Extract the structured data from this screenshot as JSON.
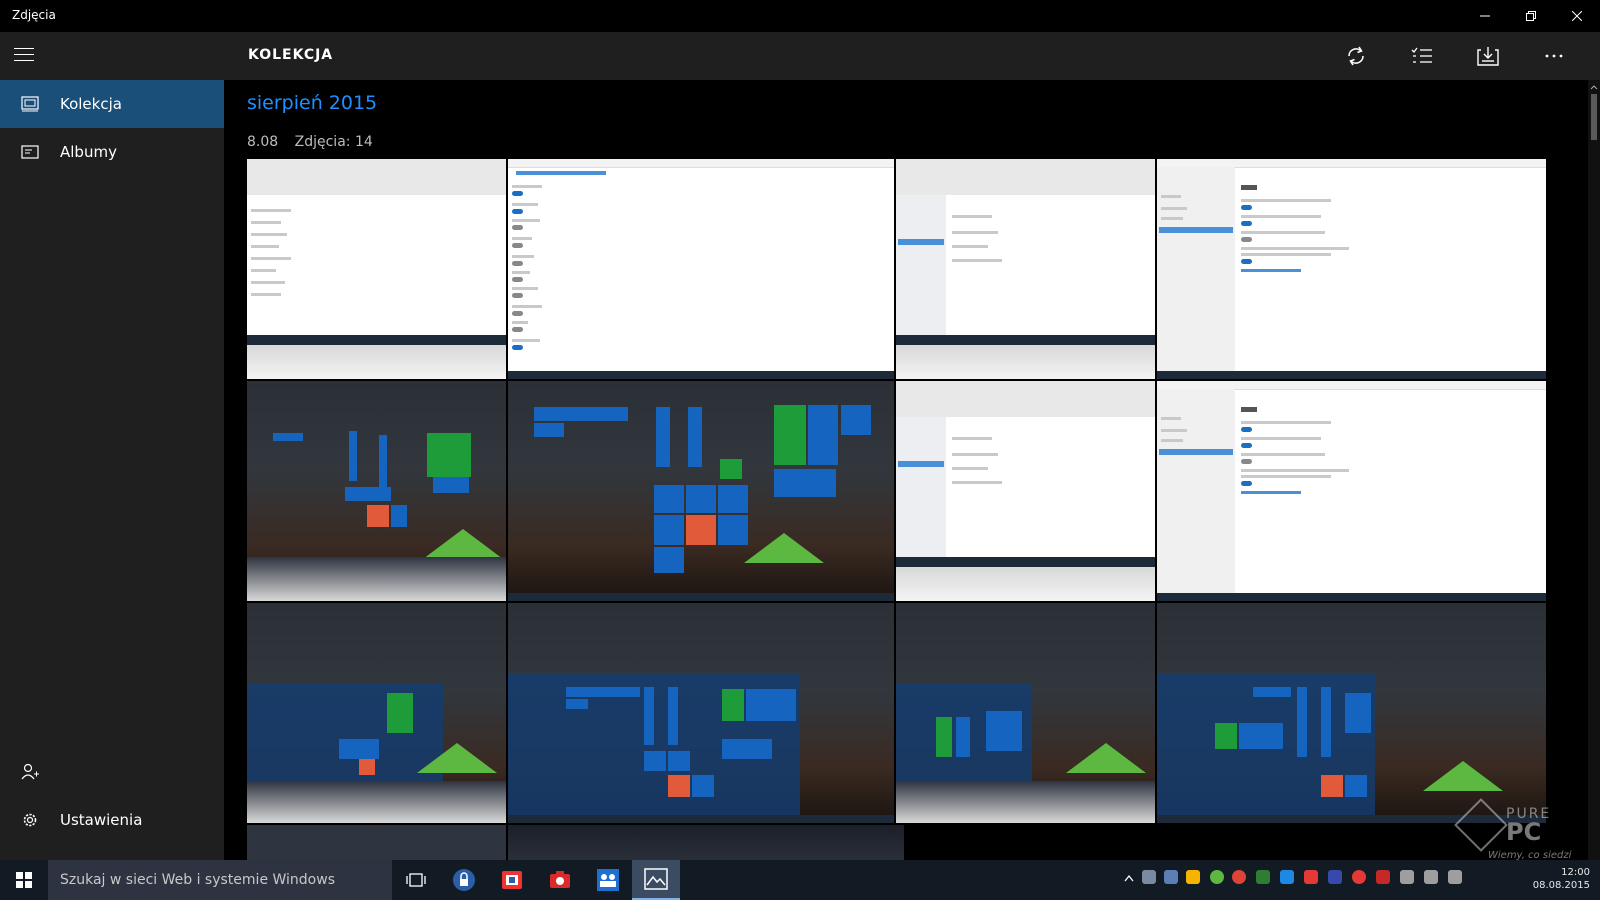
{
  "window": {
    "title": "Zdjęcia",
    "minimize_icon": "minimize-icon",
    "maximize_icon": "restore-icon",
    "close_icon": "close-icon"
  },
  "sidebar": {
    "items": [
      {
        "label": "Kolekcja",
        "icon": "collection-icon",
        "active": true
      },
      {
        "label": "Albumy",
        "icon": "album-icon",
        "active": false
      }
    ],
    "settings_label": "Ustawienia"
  },
  "header": {
    "title": "KOLEKCJA"
  },
  "collection": {
    "month": "sierpień 2015",
    "day": "8.08",
    "count": "Zdjęcia: 14"
  },
  "taskbar": {
    "search_placeholder": "Szukaj w sieci Web i systemie Windows",
    "clock_time": "12:00",
    "clock_date": "08.08.2015"
  },
  "watermark": {
    "line1": "PURE",
    "line2": "PC",
    "line3": "Wiemy, co siedzi"
  },
  "colors": {
    "accent": "#1e90ff",
    "nav_active": "#1a4f7a",
    "pane": "#1f1f1f",
    "taskbar": "#121a24"
  }
}
